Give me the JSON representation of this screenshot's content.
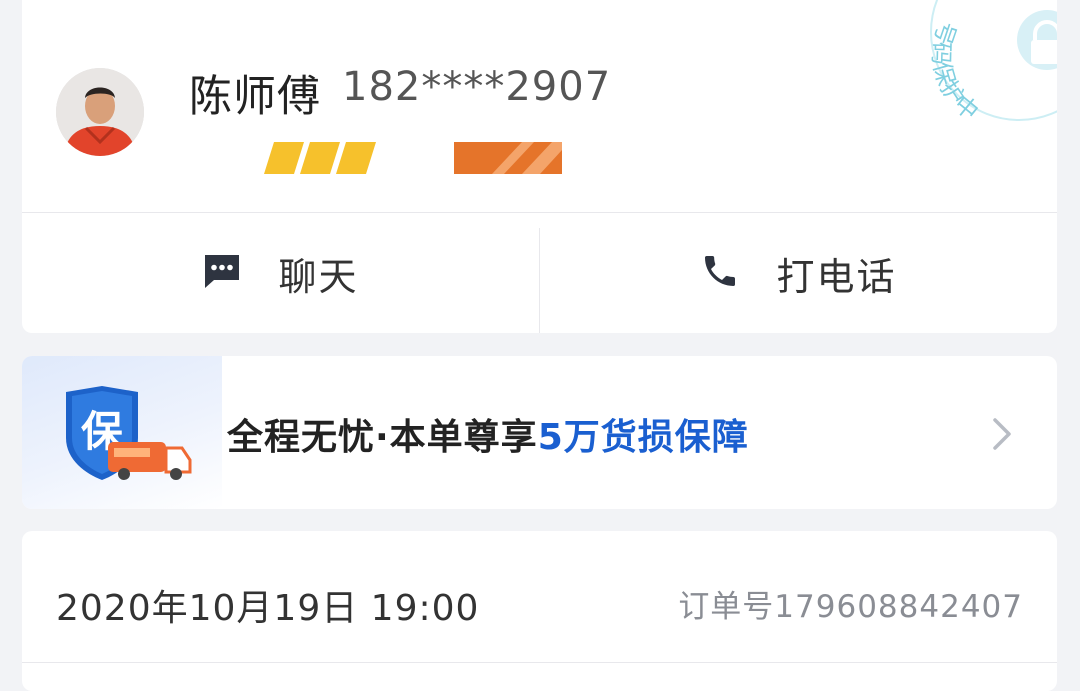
{
  "driver": {
    "name": "陈师傅",
    "phone": "182****2907",
    "seal_text": "号码保护中",
    "chat_label": "聊天",
    "call_label": "打电话"
  },
  "insurance": {
    "shield_char": "保",
    "text_main": "全程无忧·本单尊享",
    "text_highlight": "5万货损保障"
  },
  "order": {
    "datetime": "2020年10月19日 19:00",
    "order_number": "订单号179608842407"
  },
  "colors": {
    "accent_blue": "#1a5fd0",
    "seal_teal": "#7fcfe0",
    "badge_yellow": "#f6c12c",
    "badge_orange": "#e5742a"
  }
}
